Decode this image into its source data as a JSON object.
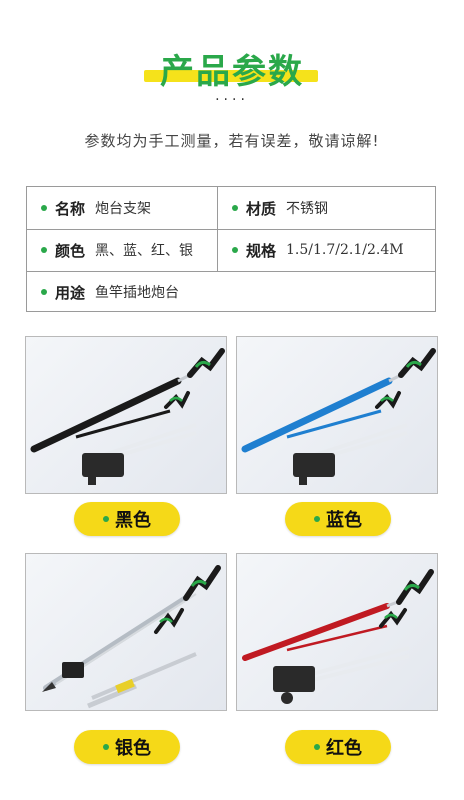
{
  "header": {
    "title": "产品参数",
    "dots": "····",
    "subtitle": "参数均为手工测量，若有误差，敬请谅解!"
  },
  "specs": {
    "name_label": "名称",
    "name_value": "炮台支架",
    "material_label": "材质",
    "material_value": "不锈钢",
    "color_label": "颜色",
    "color_value": "黑、蓝、红、银",
    "size_label": "规格",
    "size_value": "1.5/1.7/2.1/2.4M",
    "use_label": "用途",
    "use_value": "鱼竿插地炮台"
  },
  "variants": [
    {
      "label": "黑色",
      "rod_color": "#1a1a1a"
    },
    {
      "label": "蓝色",
      "rod_color": "#1f7fd0"
    },
    {
      "label": "银色",
      "rod_color": "#b5bcc4"
    },
    {
      "label": "红色",
      "rod_color": "#c01a22"
    }
  ],
  "colors": {
    "accent_green": "#2aa84a",
    "highlight_yellow": "#f5e21b"
  }
}
